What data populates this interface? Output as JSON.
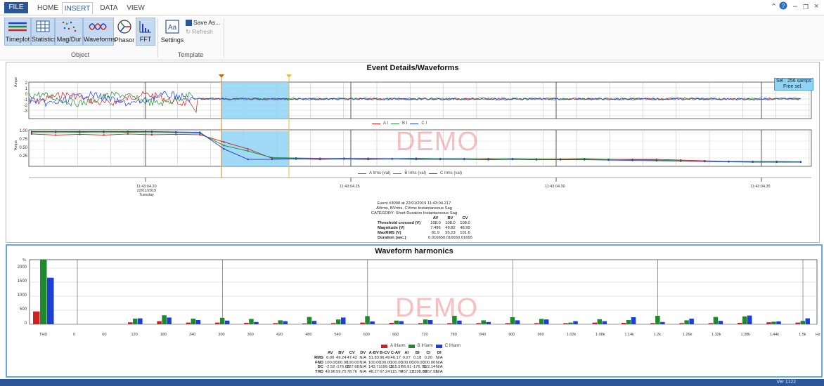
{
  "ribbon": {
    "tabs": [
      {
        "label": "FILE"
      },
      {
        "label": "HOME"
      },
      {
        "label": "INSERT"
      },
      {
        "label": "DATA"
      },
      {
        "label": "VIEW"
      }
    ],
    "object_buttons": [
      {
        "label": "Timeplot",
        "icon": "timeplot-icon",
        "selected": true
      },
      {
        "label": "Statistics",
        "icon": "statistics-icon",
        "selected": true
      },
      {
        "label": "Mag/Dur",
        "icon": "magdur-icon",
        "selected": true
      },
      {
        "label": "Waveforms",
        "icon": "waveforms-icon",
        "selected": true
      },
      {
        "label": "Phasor",
        "icon": "phasor-icon",
        "selected": false
      },
      {
        "label": "FFT",
        "icon": "fft-icon",
        "selected": true
      }
    ],
    "object_group_label": "Object",
    "template_buttons": {
      "settings": "Settings",
      "save_as": "Save As...",
      "refresh": "Refresh"
    },
    "template_group_label": "Template"
  },
  "waveforms_panel": {
    "title": "Event Details/Waveforms",
    "watermark": "DEMO",
    "selection_box": {
      "line1": "Sel : 256 samps",
      "line2": "Free sel."
    },
    "chart1": {
      "ylabel": "Amps",
      "yticks": [
        "2",
        "1",
        "0",
        "-1",
        "-2",
        "-3"
      ],
      "legend": [
        "A I",
        "B I",
        "C I"
      ]
    },
    "chart2": {
      "ylabel": "Amps",
      "yticks": [
        "1.00",
        "0.75",
        "0.50",
        "0.25"
      ],
      "legend": [
        "A Irms (val)",
        "B Irms (val)",
        "C Irms (val)"
      ]
    },
    "time_labels": [
      {
        "time": "11:43:04.20",
        "date": "22/01/2019",
        "day": "Tuesday"
      },
      {
        "time": "11:43:04.25"
      },
      {
        "time": "11:43:04.30"
      },
      {
        "time": "11:43:04.35"
      }
    ],
    "event": {
      "line1": "Event #3000 at 22/01/2019 11:43:04.217",
      "line2": "AVrms, BVrms, CVrms Instantaneous Sag",
      "line3": "CATEGORY: Short Duration Instantaneous Sag",
      "columns": [
        "AV",
        "BV",
        "CV"
      ],
      "rows": [
        {
          "label": "Threshold crossed (V)",
          "values": [
            "108.0",
            "108.0",
            "108.0"
          ]
        },
        {
          "label": "Magnitude (V)",
          "values": [
            "7.496",
            "49.82",
            "48.99"
          ]
        },
        {
          "label": "MaxRMS (V)",
          "values": [
            "81.9",
            "95.23",
            "101.6"
          ]
        },
        {
          "label": "Duration (sec.)",
          "values": [
            "0.01665",
            "0.01665",
            "0.01665"
          ]
        }
      ]
    }
  },
  "harmonics_panel": {
    "title": "Waveform harmonics",
    "watermark": "DEMO",
    "ylabel": "%",
    "xunit": "Hz",
    "legend": [
      "A IHarm",
      "B IHarm",
      "C IHarm"
    ],
    "table": {
      "columns": [
        "AV",
        "BV",
        "CV",
        "DV",
        "A-BV",
        "B-CV",
        "C-AV",
        "AI",
        "BI",
        "CI",
        "DI"
      ],
      "rows": [
        {
          "label": "RMS",
          "values": [
            "6.00",
            "49.24",
            "47.42",
            "N/A",
            "51.83",
            "96.49",
            "46.17",
            "0.27",
            "0.18",
            "0.20",
            "N/A"
          ]
        },
        {
          "label": "FND",
          "values": [
            "100.00",
            "100.00",
            "100.00",
            "N/A",
            "100.00",
            "100.00",
            "100.00",
            "100.00",
            "100.00",
            "100.00",
            "N/A"
          ]
        },
        {
          "label": "DC",
          "values": [
            "-2.52",
            "-176.65",
            "227.68",
            "N/A",
            "143.71",
            "-199.15",
            "315.57",
            "66.91",
            "-176.73",
            "922.14",
            "N/A"
          ]
        },
        {
          "label": "THD",
          "values": [
            "49.96",
            "59.75",
            "78.76",
            "N/A",
            "48.27",
            "67.24",
            "115.76",
            "457.13",
            "2298.80",
            "1657.92",
            "N/A"
          ]
        }
      ]
    }
  },
  "colors": {
    "a": "#cc2222",
    "b": "#1e8a2e",
    "c": "#1c3fd6",
    "selection": "#8fd3f5",
    "accent": "#2b579a"
  },
  "chart_data": [
    {
      "type": "line",
      "title": "",
      "ylabel": "Amps",
      "x": [
        "11:43:04.20",
        "11:43:04.25",
        "11:43:04.30",
        "11:43:04.35"
      ],
      "ylim": [
        -3,
        2
      ],
      "series": [
        {
          "name": "A I"
        },
        {
          "name": "B I"
        },
        {
          "name": "C I"
        }
      ]
    },
    {
      "type": "line",
      "title": "",
      "ylabel": "Amps",
      "ylim": [
        0,
        1.05
      ],
      "x": [
        "11:43:04.195",
        "11:43:04.20",
        "11:43:04.205",
        "11:43:04.21",
        "11:43:04.215",
        "11:43:04.22",
        "11:43:04.225",
        "11:43:04.23",
        "11:43:04.235",
        "11:43:04.24",
        "11:43:04.245",
        "11:43:04.25",
        "11:43:04.255",
        "11:43:04.26",
        "11:43:04.265",
        "11:43:04.27",
        "11:43:04.275",
        "11:43:04.28",
        "11:43:04.285",
        "11:43:04.29",
        "11:43:04.295",
        "11:43:04.30",
        "11:43:04.305",
        "11:43:04.31",
        "11:43:04.315",
        "11:43:04.32",
        "11:43:04.325",
        "11:43:04.33",
        "11:43:04.335",
        "11:43:04.34",
        "11:43:04.345",
        "11:43:04.35",
        "11:43:04.355"
      ],
      "series": [
        {
          "name": "A Irms (val)",
          "values": [
            0.93,
            0.9,
            0.92,
            0.9,
            0.93,
            0.91,
            0.92,
            0.91,
            0.7,
            0.5,
            0.23,
            0.23,
            0.22,
            0.23,
            0.22,
            0.22,
            0.23,
            0.22,
            0.22,
            0.21,
            0.22,
            0.21,
            0.21,
            0.22,
            0.2,
            0.2,
            0.2,
            0.18,
            0.16,
            0.14,
            0.14,
            0.14,
            0.13
          ]
        },
        {
          "name": "B Irms (val)",
          "values": [
            0.97,
            0.97,
            0.98,
            0.97,
            0.98,
            0.97,
            0.97,
            0.95,
            0.6,
            0.44,
            0.25,
            0.24,
            0.23,
            0.22,
            0.23,
            0.22,
            0.21,
            0.22,
            0.21,
            0.22,
            0.21,
            0.21,
            0.2,
            0.21,
            0.2,
            0.19,
            0.18,
            0.16,
            0.15,
            0.14,
            0.14,
            0.14,
            0.13
          ]
        },
        {
          "name": "C Irms (val)",
          "values": [
            1.0,
            1.0,
            1.0,
            1.0,
            1.0,
            1.0,
            0.99,
            0.98,
            0.5,
            0.2,
            0.2,
            0.21,
            0.2,
            0.21,
            0.2,
            0.21,
            0.2,
            0.2,
            0.2,
            0.19,
            0.2,
            0.19,
            0.19,
            0.19,
            0.18,
            0.17,
            0.16,
            0.15,
            0.14,
            0.13,
            0.12,
            0.12,
            0.12
          ]
        }
      ]
    },
    {
      "type": "bar",
      "title": "Waveform harmonics",
      "ylabel": "%",
      "xlabel": "Hz",
      "ylim": [
        0,
        2300
      ],
      "categories": [
        "THD",
        "0",
        "60",
        "120",
        "180",
        "240",
        "300",
        "360",
        "420",
        "480",
        "540",
        "600",
        "660",
        "720",
        "780",
        "840",
        "900",
        "960",
        "1.02k",
        "1.08k",
        "1.14k",
        "1.2k",
        "1.26k",
        "1.32k",
        "1.38k",
        "1.44k",
        "1.5k"
      ],
      "series": [
        {
          "name": "A IHarm",
          "values": [
            457,
            0,
            0,
            70,
            110,
            60,
            60,
            50,
            40,
            30,
            40,
            60,
            50,
            40,
            40,
            40,
            40,
            40,
            40,
            60,
            50,
            40,
            40,
            40,
            50,
            70,
            60
          ]
        },
        {
          "name": "B IHarm",
          "values": [
            2299,
            0,
            0,
            200,
            320,
            200,
            230,
            190,
            140,
            260,
            170,
            290,
            130,
            170,
            300,
            140,
            250,
            190,
            60,
            180,
            150,
            300,
            140,
            260,
            280,
            90,
            120
          ]
        },
        {
          "name": "C IHarm",
          "values": [
            1658,
            0,
            0,
            210,
            240,
            150,
            130,
            80,
            110,
            120,
            240,
            100,
            110,
            150,
            130,
            80,
            140,
            170,
            110,
            110,
            250,
            80,
            200,
            120,
            310,
            100,
            210
          ]
        }
      ],
      "yticks": [
        "2000",
        "1500",
        "1000",
        "500",
        "0"
      ]
    }
  ],
  "status": {
    "text": "Ver 1122"
  }
}
